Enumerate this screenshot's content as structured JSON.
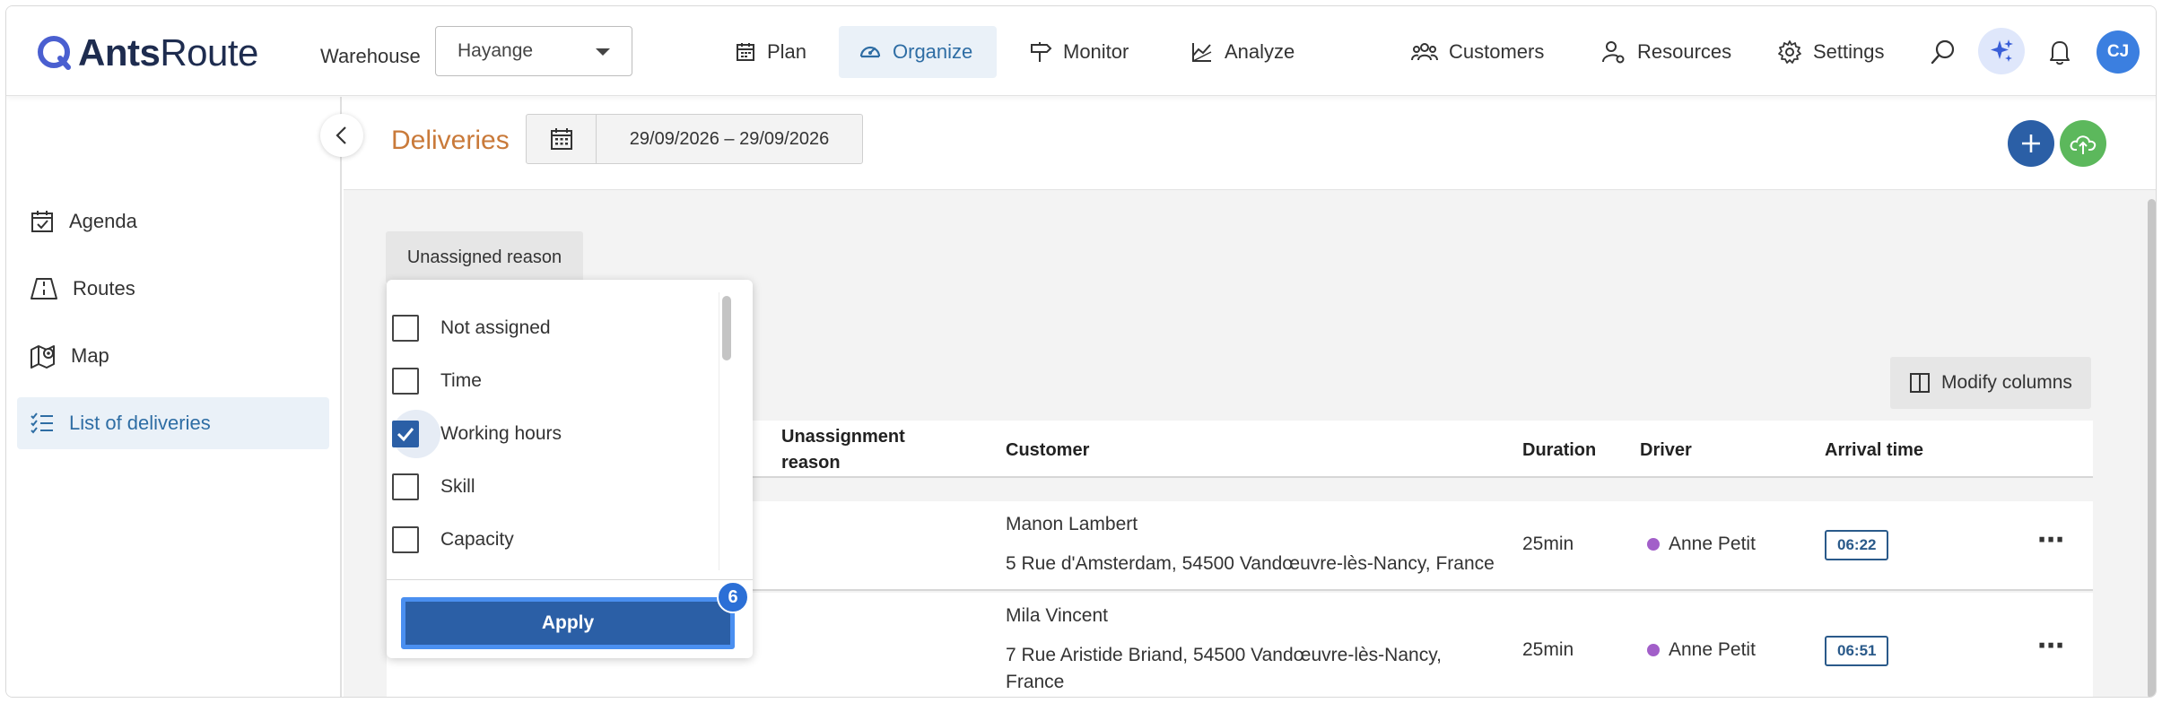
{
  "app": {
    "logo_strong": "Ants",
    "logo_light": "Route"
  },
  "header": {
    "warehouse_label": "Warehouse",
    "warehouse_value": "Hayange",
    "nav": {
      "plan": "Plan",
      "organize": "Organize",
      "monitor": "Monitor",
      "analyze": "Analyze",
      "customers": "Customers",
      "resources": "Resources",
      "settings": "Settings"
    },
    "avatar_initials": "CJ",
    "active_nav": "Organize",
    "accent_color": "#2e6da4"
  },
  "sidebar": {
    "items": [
      {
        "label": "Agenda",
        "icon": "calendar-check-icon"
      },
      {
        "label": "Routes",
        "icon": "road-icon"
      },
      {
        "label": "Map",
        "icon": "map-pin-icon"
      },
      {
        "label": "List of deliveries",
        "icon": "list-check-icon",
        "active": true
      }
    ]
  },
  "page": {
    "title": "Deliveries",
    "date_range": "29/09/2026 – 29/09/2026",
    "title_color": "#c97a3a"
  },
  "filter": {
    "chip_label": "Unassigned reason",
    "options": [
      {
        "label": "Not assigned",
        "checked": false
      },
      {
        "label": "Time",
        "checked": false
      },
      {
        "label": "Working hours",
        "checked": true
      },
      {
        "label": "Skill",
        "checked": false
      },
      {
        "label": "Capacity",
        "checked": false
      }
    ],
    "apply_label": "Apply",
    "apply_badge": "6"
  },
  "toolbar": {
    "modify_columns_label": "Modify columns"
  },
  "table": {
    "columns": {
      "unassignment_reason_line1": "Unassignment",
      "unassignment_reason_line2": "reason",
      "customer": "Customer",
      "duration": "Duration",
      "driver": "Driver",
      "arrival_time": "Arrival time"
    },
    "rows": [
      {
        "customer_name": "Manon Lambert",
        "address_line1": "5 Rue d'Amsterdam, 54500 Vandœuvre-lès-Nancy, France",
        "address_line2": "",
        "duration": "25min",
        "driver": "Anne Petit",
        "arrival_time": "06:22"
      },
      {
        "customer_name": "Mila Vincent",
        "address_line1": "7 Rue Aristide Briand, 54500 Vandœuvre-lès-Nancy,",
        "address_line2": "France",
        "duration": "25min",
        "driver": "Anne Petit",
        "arrival_time": "06:51"
      }
    ]
  }
}
